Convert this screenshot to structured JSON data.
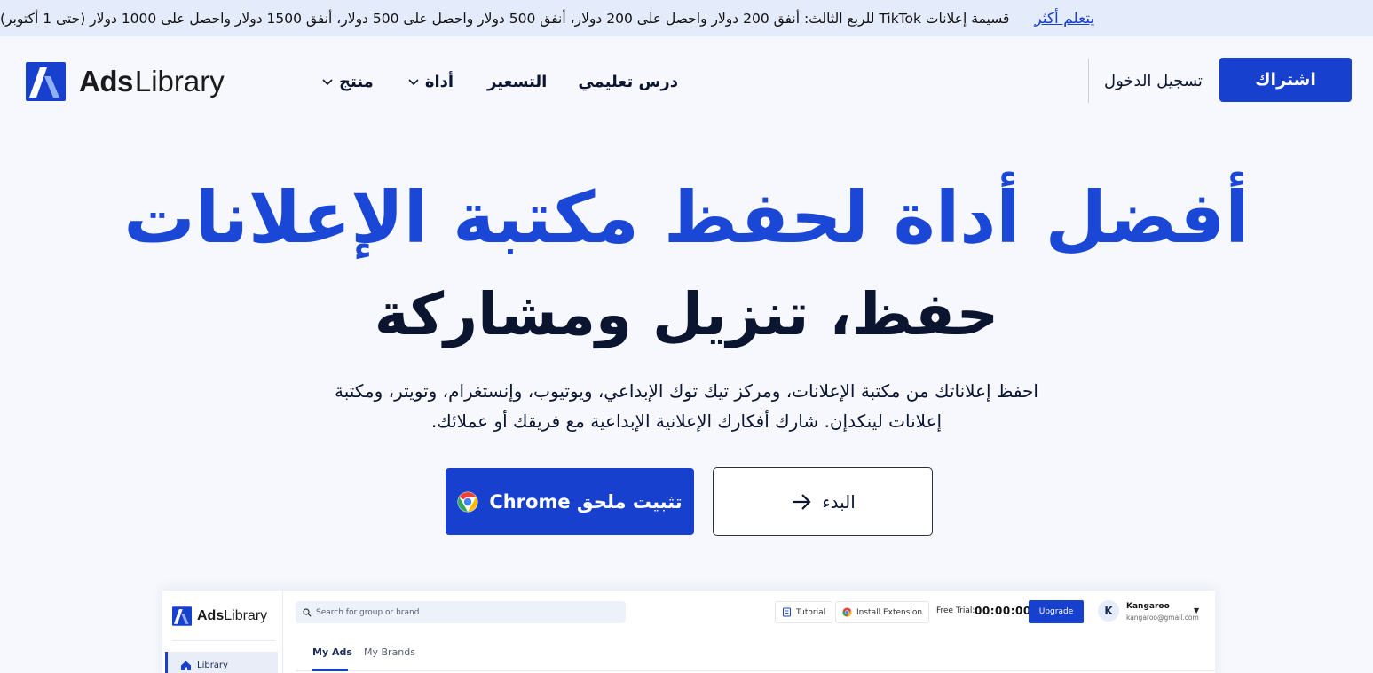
{
  "promo": {
    "link": "يتعلم أكثر",
    "text": "قسيمة إعلانات TikTok للربع الثالث: أنفق 200 دولار واحصل على 200 دولار، أنفق 500 دولار واحصل على 500 دولار، أنفق 1500 دولار واحصل على 1000 دولار (حتى 1 أكتوبر)"
  },
  "logo": {
    "ads": "Ads",
    "library": "Library"
  },
  "nav": {
    "items": [
      {
        "label": "درس تعليمي",
        "dropdown": false
      },
      {
        "label": "التسعير",
        "dropdown": false
      },
      {
        "label": "أداة",
        "dropdown": true
      },
      {
        "label": "منتج",
        "dropdown": true
      }
    ],
    "login": "تسجيل الدخول",
    "signup": "اشتراك"
  },
  "hero": {
    "title": "أفضل أداة لحفظ مكتبة الإعلانات",
    "subtitle": "حفظ، تنزيل ومشاركة",
    "description_line1": "احفظ إعلاناتك من مكتبة الإعلانات، ومركز تيك توك الإبداعي، ويوتيوب، وإنستغرام، وتويتر، ومكتبة",
    "description_line2": "إعلانات لينكدإن. شارك أفكارك الإعلانية الإبداعية مع فريقك أو عملائك.",
    "install_button": "تثبيت ملحق Chrome",
    "start_button": "البدء"
  },
  "preview": {
    "logo_ads": "Ads",
    "logo_library": "Library",
    "sidebar_item": "Library",
    "search_placeholder": "Search for group or brand",
    "tutorial": "Tutorial",
    "install_extension": "Install Extension",
    "free_trial_label": "Free Trial:",
    "timer": "00:00:00",
    "upgrade": "Upgrade",
    "avatar_initial": "K",
    "user_name": "Kangaroo",
    "user_email": "kangaroo@gmail.com",
    "tabs": [
      "My Ads",
      "My Brands"
    ]
  },
  "colors": {
    "brand": "#1740cf",
    "heading_blue": "#1a47d6",
    "dark": "#0b1530",
    "promo_bg": "#e4ebfb"
  },
  "icons": [
    "chevron-down-icon",
    "chrome-icon",
    "arrow-right-icon",
    "search-icon",
    "home-icon",
    "tutorial-icon",
    "caret-down-icon"
  ]
}
